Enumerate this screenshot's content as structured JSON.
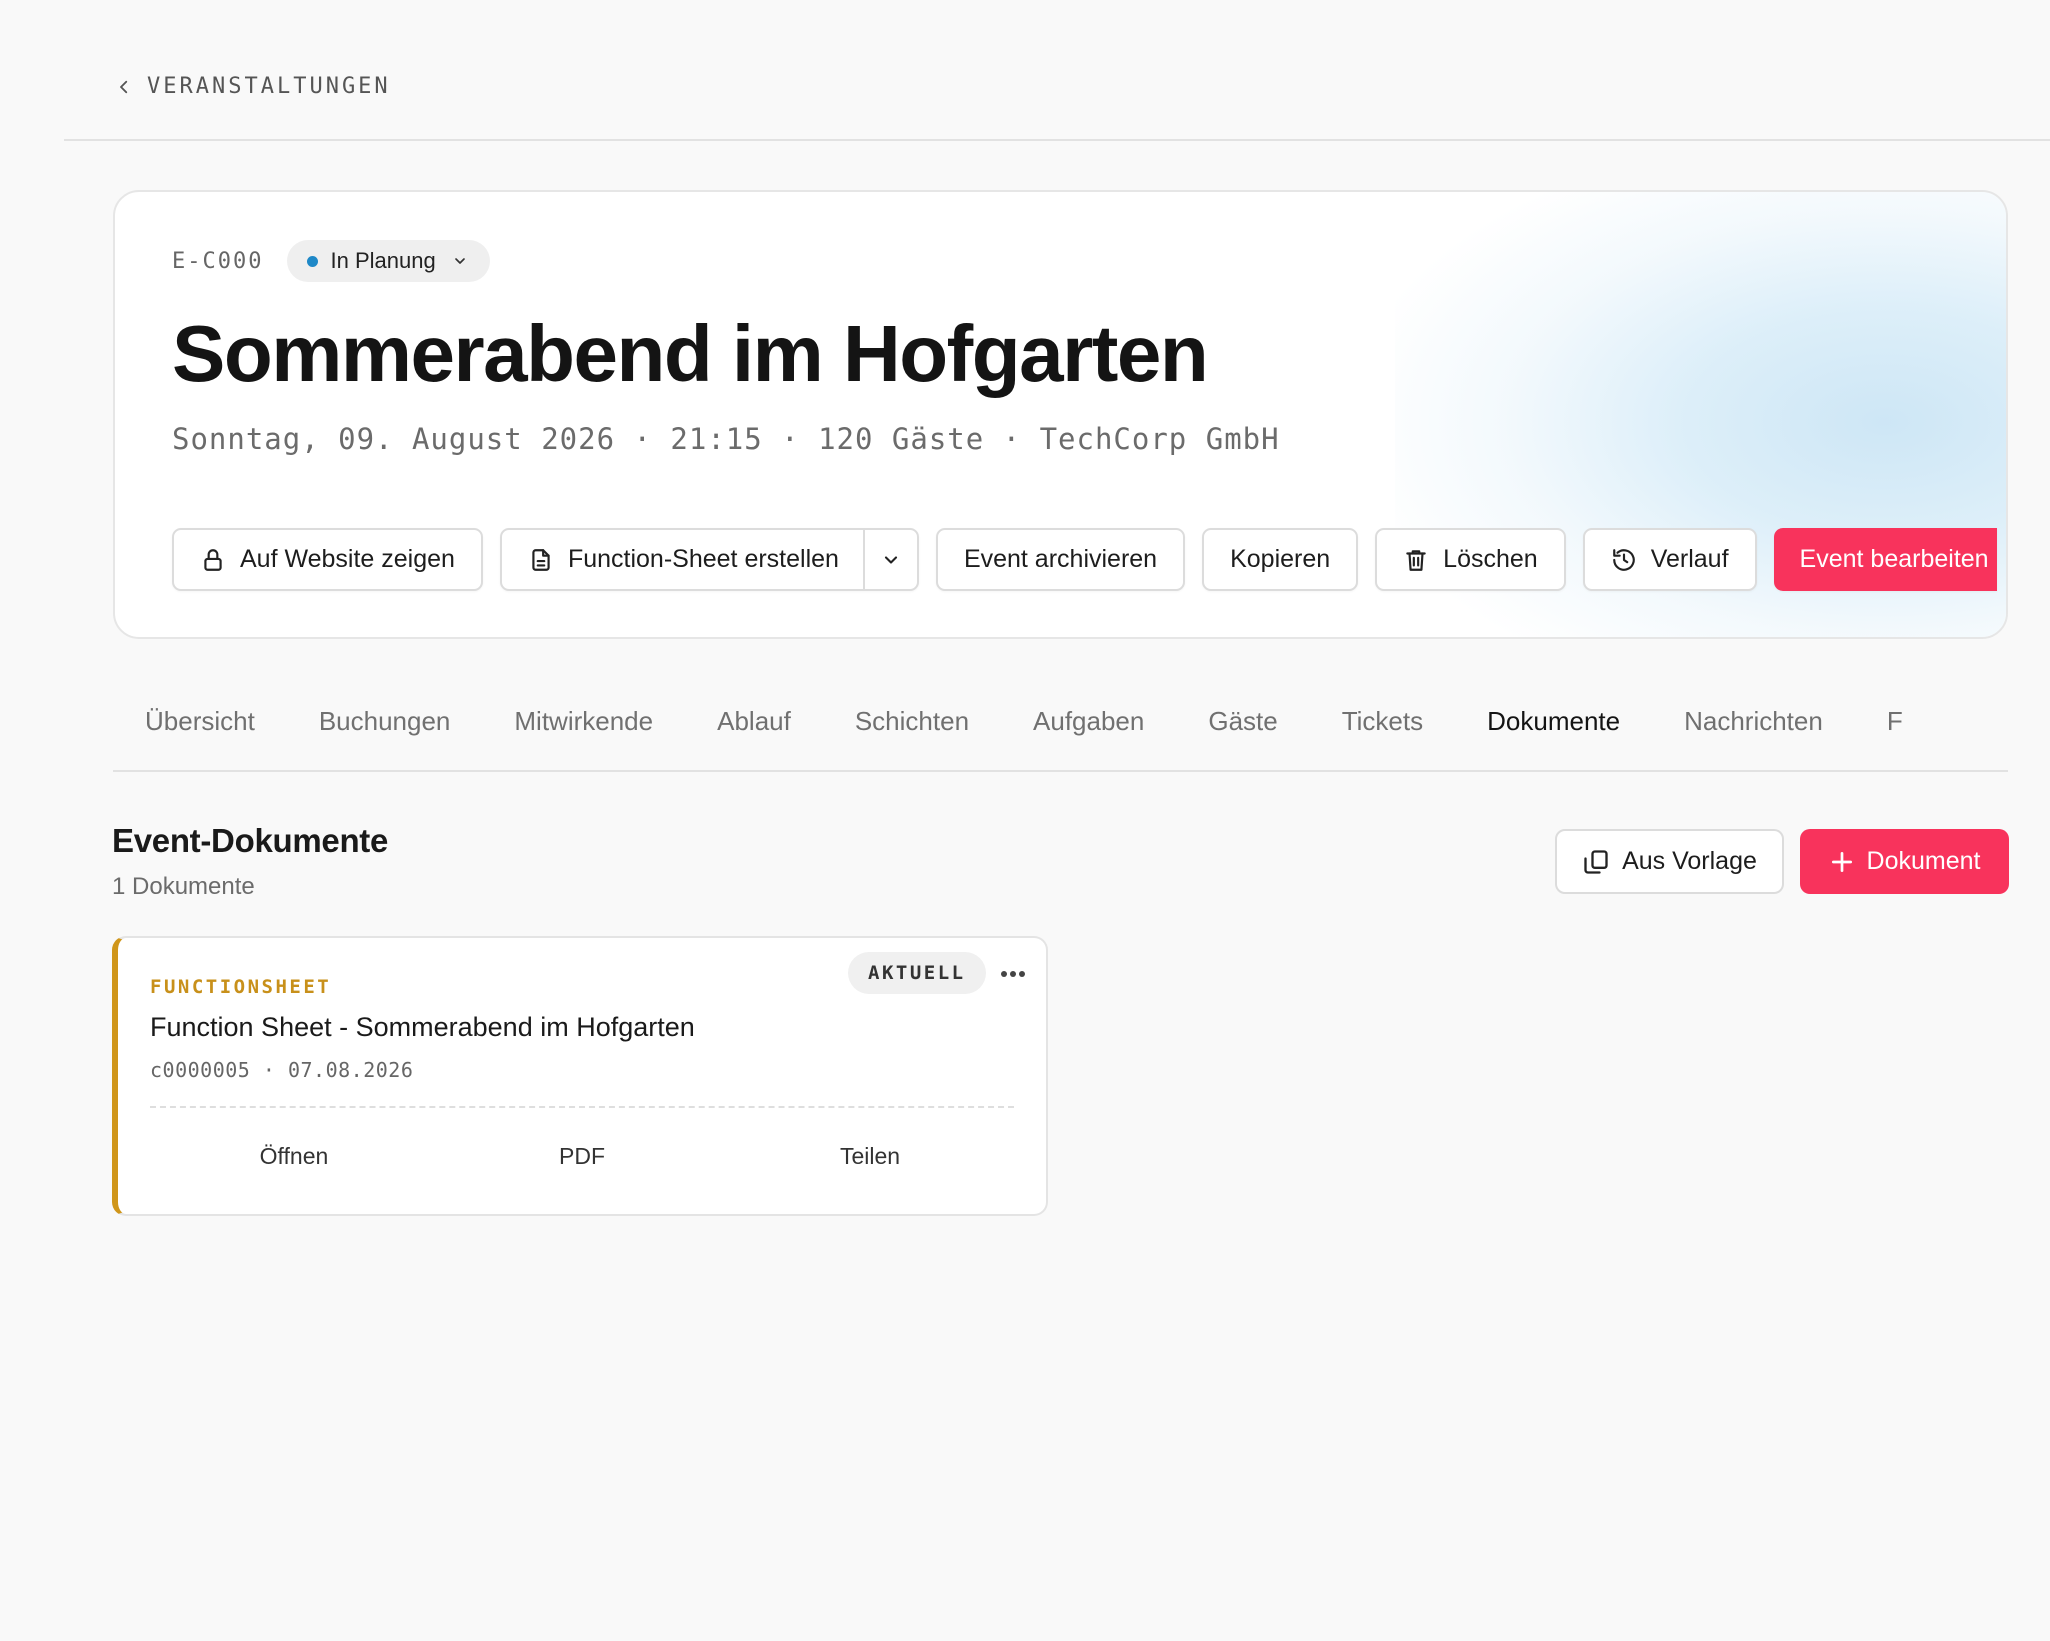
{
  "breadcrumb": {
    "label": "VERANSTALTUNGEN"
  },
  "event": {
    "id": "E-C000",
    "status": "In Planung",
    "title": "Sommerabend im Hofgarten",
    "meta": "Sonntag, 09. August 2026 · 21:15 · 120 Gäste · TechCorp GmbH"
  },
  "actions": {
    "show_website": "Auf Website zeigen",
    "function_sheet": "Function-Sheet erstellen",
    "archive": "Event archivieren",
    "copy": "Kopieren",
    "delete": "Löschen",
    "history": "Verlauf",
    "edit": "Event bearbeiten"
  },
  "tabs": [
    {
      "label": "Übersicht"
    },
    {
      "label": "Buchungen"
    },
    {
      "label": "Mitwirkende"
    },
    {
      "label": "Ablauf"
    },
    {
      "label": "Schichten"
    },
    {
      "label": "Aufgaben"
    },
    {
      "label": "Gäste"
    },
    {
      "label": "Tickets"
    },
    {
      "label": "Dokumente",
      "active": true
    },
    {
      "label": "Nachrichten"
    },
    {
      "label": "F"
    }
  ],
  "documents": {
    "title": "Event-Dokumente",
    "count": "1 Dokumente",
    "from_template": "Aus Vorlage",
    "add": "Dokument",
    "items": [
      {
        "type": "FUNCTIONSHEET",
        "badge": "AKTUELL",
        "title": "Function Sheet - Sommerabend im Hofgarten",
        "meta": "c0000005 · 07.08.2026",
        "actions": [
          "Öffnen",
          "PDF",
          "Teilen"
        ]
      }
    ]
  },
  "colors": {
    "accent": "#f8335c",
    "status_dot": "#1e88c7",
    "doc_type": "#c8901a"
  }
}
